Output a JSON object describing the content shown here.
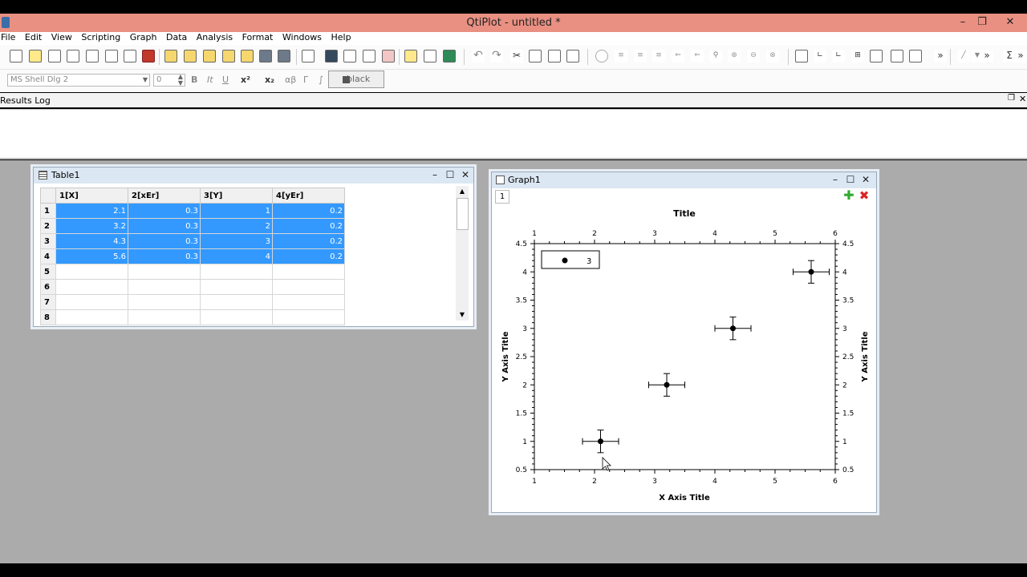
{
  "app": {
    "title": "QtiPlot - untitled *"
  },
  "menu": [
    "File",
    "Edit",
    "View",
    "Scripting",
    "Graph",
    "Data",
    "Analysis",
    "Format",
    "Windows",
    "Help"
  ],
  "format_bar": {
    "font": "MS Shell Dlg 2",
    "size": "0",
    "bold": "B",
    "italic": "It",
    "underline": "U",
    "superscript": "x²",
    "subscript": "x₂",
    "greek": "αβ",
    "greek_upper": "Γ",
    "integral": "∫",
    "color": "black"
  },
  "results": {
    "title": "Results Log"
  },
  "table": {
    "title": "Table1",
    "columns": [
      "1[X]",
      "2[xEr]",
      "3[Y]",
      "4[yEr]"
    ],
    "row_numbers": [
      "1",
      "2",
      "3",
      "4",
      "5",
      "6",
      "7",
      "8"
    ],
    "rows": [
      [
        "2.1",
        "0.3",
        "1",
        "0.2"
      ],
      [
        "3.2",
        "0.3",
        "2",
        "0.2"
      ],
      [
        "4.3",
        "0.3",
        "3",
        "0.2"
      ],
      [
        "5.6",
        "0.3",
        "4",
        "0.2"
      ]
    ]
  },
  "graph": {
    "title": "Graph1",
    "layer_tab": "1",
    "plot_title": "Title",
    "x_axis_title": "X Axis Title",
    "y_axis_title": "Y Axis Title",
    "legend_label": "3",
    "x_ticks": [
      "1",
      "2",
      "3",
      "4",
      "5",
      "6"
    ],
    "y_ticks": [
      "0.5",
      "1",
      "1.5",
      "2",
      "2.5",
      "3",
      "3.5",
      "4",
      "4.5"
    ]
  },
  "chart_data": {
    "type": "scatter",
    "title": "Title",
    "xlabel": "X Axis Title",
    "ylabel": "Y Axis Title",
    "xlim": [
      1,
      6
    ],
    "ylim": [
      0.5,
      4.5
    ],
    "grid": false,
    "legend_placement": "top-left",
    "series": [
      {
        "name": "3",
        "x": [
          2.1,
          3.2,
          4.3,
          5.6
        ],
        "y": [
          1,
          2,
          3,
          4
        ],
        "x_error": [
          0.3,
          0.3,
          0.3,
          0.3
        ],
        "y_error": [
          0.2,
          0.2,
          0.2,
          0.2
        ]
      }
    ]
  }
}
